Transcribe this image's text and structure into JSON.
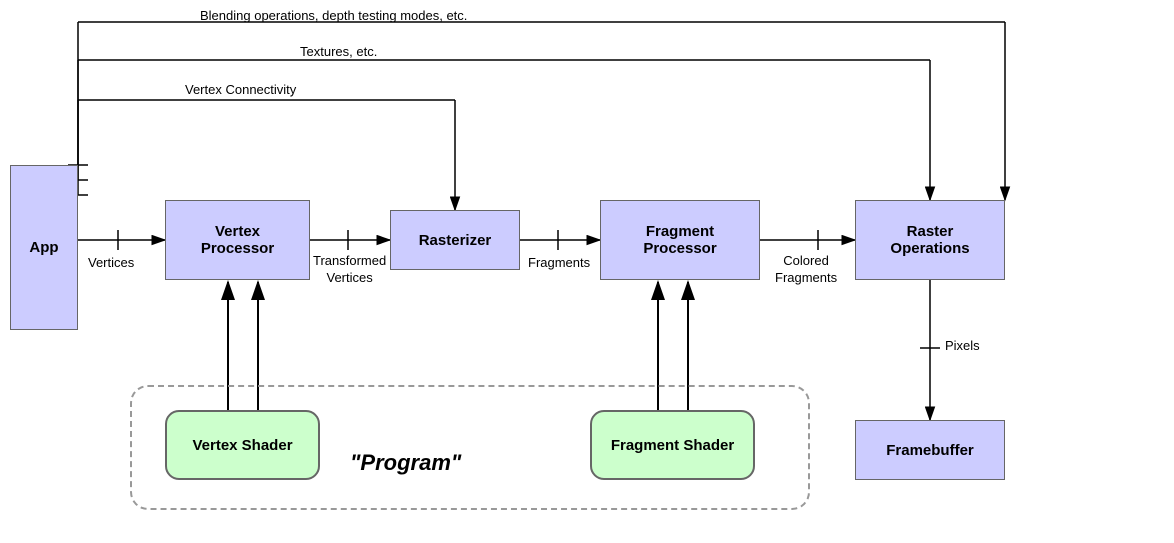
{
  "boxes": {
    "app": "App",
    "vertex_processor": "Vertex\nProcessor",
    "rasterizer": "Rasterizer",
    "fragment_processor": "Fragment\nProcessor",
    "raster_operations": "Raster\nOperations",
    "framebuffer": "Framebuffer",
    "vertex_shader": "Vertex Shader",
    "fragment_shader": "Fragment Shader",
    "program": "\"Program\""
  },
  "labels": {
    "blending": "Blending operations, depth testing modes, etc.",
    "textures": "Textures, etc.",
    "vertex_connectivity": "Vertex Connectivity",
    "vertices": "Vertices",
    "transformed_vertices": "Transformed\nVertices",
    "fragments": "Fragments",
    "colored_fragments": "Colored\nFragments",
    "pixels": "Pixels"
  }
}
